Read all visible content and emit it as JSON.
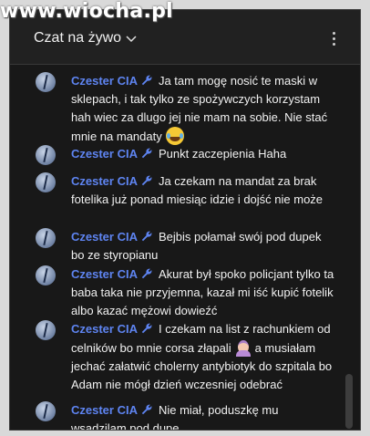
{
  "watermark": "www.wiocha.pl",
  "header": {
    "title": "Czat na żywo"
  },
  "messages": [
    {
      "author": "Czester CIA",
      "text": "Ja tam mogę nosić te maski w sklepach, i tak tylko ze spożywczych korzystam hah wiec za dlugo jej nie mam na sobie. Nie stać mnie na mandaty",
      "emoji": "face-with-tears-of-joy"
    },
    {
      "author": "Czester CIA",
      "text": "Punkt zaczepienia Haha"
    },
    {
      "author": "Czester CIA",
      "text": "Ja czekam na mandat za brak fotelika już ponad miesiąc idzie i dojść nie może"
    },
    {
      "author": "Czester CIA",
      "text": "Bejbis połamał swój pod dupek bo ze styropianu"
    },
    {
      "author": "Czester CIA",
      "text": "Akurat był spoko policjant tylko ta baba taka nie przyjemna, kazał mi iść kupić fotelik albo kazać mężowi dowieźć"
    },
    {
      "author": "Czester CIA",
      "text_before": "I czekam na list z rachunkiem od celników bo mnie corsa złapali",
      "emoji": "woman-facepalming",
      "text_after": "a musiałam jechać załatwić cholerny antybiotyk do szpitala bo Adam nie mógł dzień wczesniej odebrać"
    },
    {
      "author": "Czester CIA",
      "text": "Nie miał, poduszkę mu wsadzilam pod dupe"
    }
  ],
  "colors": {
    "author": "#5e84f1",
    "background": "#181818",
    "text": "#f1f1f1"
  }
}
